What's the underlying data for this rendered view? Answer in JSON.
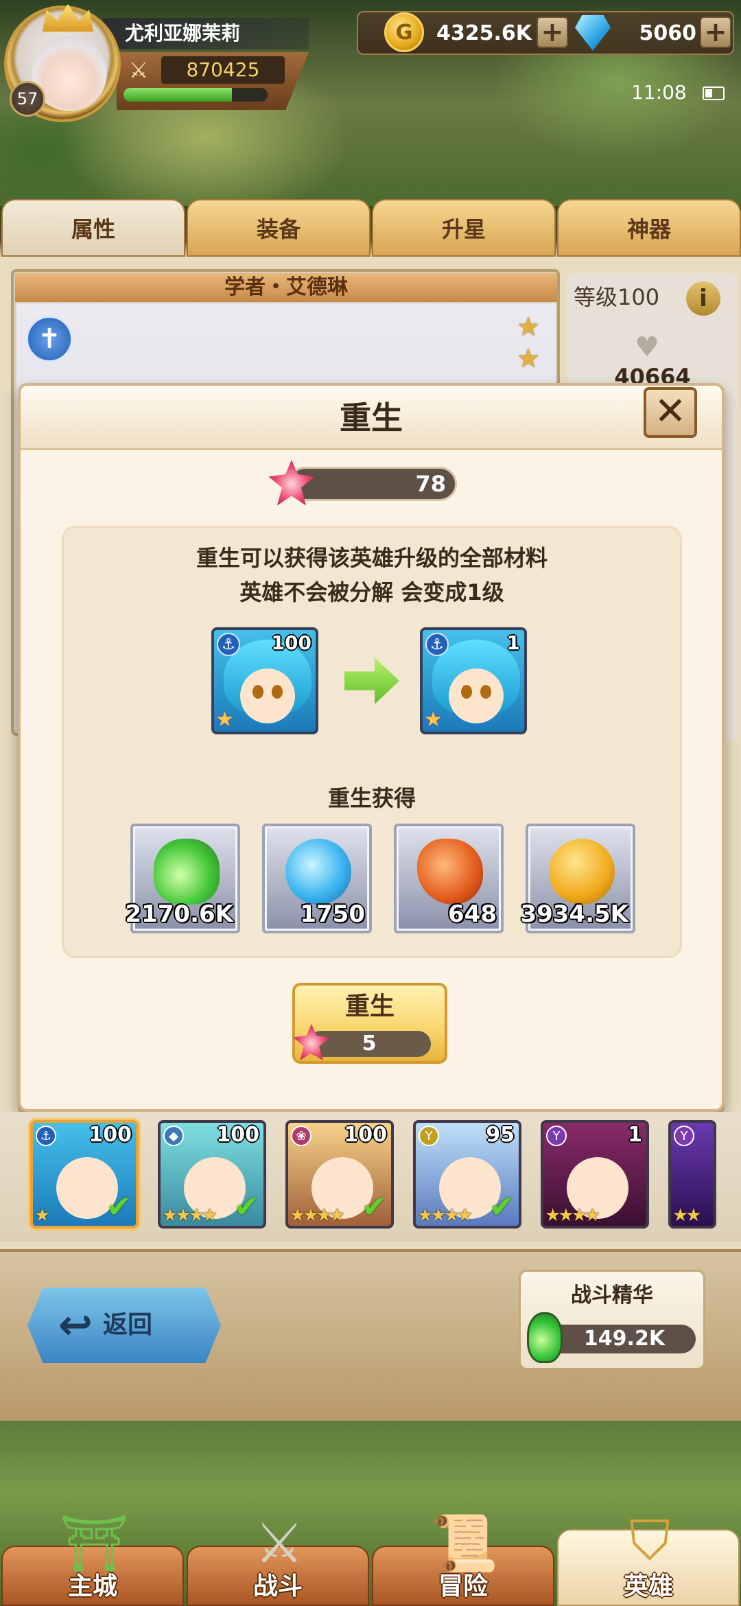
{
  "player": {
    "name": "尤利亚娜茉莉",
    "level": "57",
    "power": "870425",
    "xp_fraction": 0.75
  },
  "currency": {
    "gold": "4325.6K",
    "gems": "5060"
  },
  "status": {
    "time": "11:08"
  },
  "tabs": [
    {
      "label": "属性",
      "active": true
    },
    {
      "label": "装备",
      "active": false
    },
    {
      "label": "升星",
      "active": false
    },
    {
      "label": "神器",
      "active": false
    }
  ],
  "hero": {
    "title": "学者・艾德琳",
    "level_text": "等级100",
    "hp": "40664"
  },
  "modal": {
    "title": "重生",
    "token_count": "78",
    "desc_line1": "重生可以获得该英雄升级的全部材料",
    "desc_line2": "英雄不会被分解 会变成1级",
    "from_level": "100",
    "to_level": "1",
    "reward_label": "重生获得",
    "rewards": [
      {
        "icon": "green-potion-icon",
        "value": "2170.6K"
      },
      {
        "icon": "blue-orb-icon",
        "value": "1750"
      },
      {
        "icon": "orange-rune-stone-icon",
        "value": "648"
      },
      {
        "icon": "gold-coin-icon",
        "value": "3934.5K"
      }
    ],
    "button_label": "重生",
    "button_cost": "5"
  },
  "hero_list": [
    {
      "level": "100",
      "selected": true
    },
    {
      "level": "100",
      "selected": false
    },
    {
      "level": "100",
      "selected": false
    },
    {
      "level": "95",
      "selected": false
    },
    {
      "level": "1",
      "selected": false
    }
  ],
  "bottom": {
    "back_label": "返回",
    "essence_title": "战斗精华",
    "essence_value": "149.2K"
  },
  "nav": [
    {
      "label": "主城",
      "active": false
    },
    {
      "label": "战斗",
      "active": false
    },
    {
      "label": "冒险",
      "active": false
    },
    {
      "label": "英雄",
      "active": true
    }
  ],
  "colors": {
    "accent_gold": "#f8d46a",
    "panel_cream": "#fbf3e6",
    "brown_text": "#3a2a1c"
  }
}
